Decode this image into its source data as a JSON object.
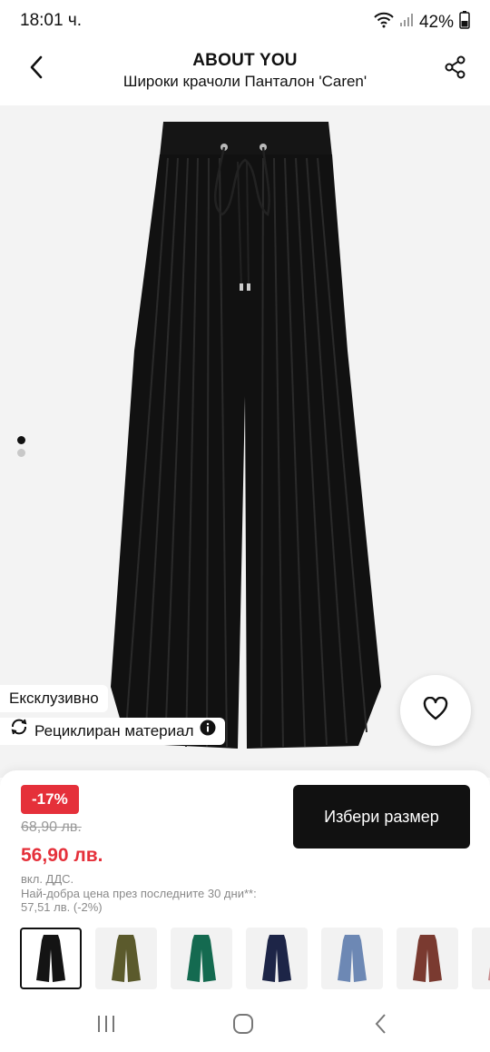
{
  "status_bar": {
    "time": "18:01 ч.",
    "battery": "42%"
  },
  "header": {
    "brand": "ABOUT YOU",
    "title": "Широки крачоли Панталон 'Caren'"
  },
  "gallery": {
    "pages": 2,
    "active_page": 1,
    "badges": {
      "exclusive": "Ексклузивно",
      "recycled": "Рециклиран материал"
    }
  },
  "purchase": {
    "discount": "-17%",
    "old_price": "68,90 лв.",
    "new_price": "56,90 лв.",
    "vat_note": "вкл. ДДС.",
    "best_price_line1": "Най-добра цена през последните 30 дни**:",
    "best_price_line2": "57,51 лв. (-2%)",
    "select_size": "Избери размер"
  },
  "variants": [
    {
      "name": "black",
      "color": "#141414",
      "selected": true
    },
    {
      "name": "olive",
      "color": "#5b5a2c",
      "selected": false
    },
    {
      "name": "green",
      "color": "#146a50",
      "selected": false
    },
    {
      "name": "navy",
      "color": "#1d2547",
      "selected": false
    },
    {
      "name": "light-blue",
      "color": "#6d88b4",
      "selected": false
    },
    {
      "name": "rust",
      "color": "#7a3a30",
      "selected": false
    },
    {
      "name": "pink",
      "color": "#c98a8c",
      "selected": false
    }
  ],
  "colors": {
    "accent_red": "#e5303a",
    "button_dark": "#111111",
    "gallery_bg": "#f3f3f3"
  }
}
